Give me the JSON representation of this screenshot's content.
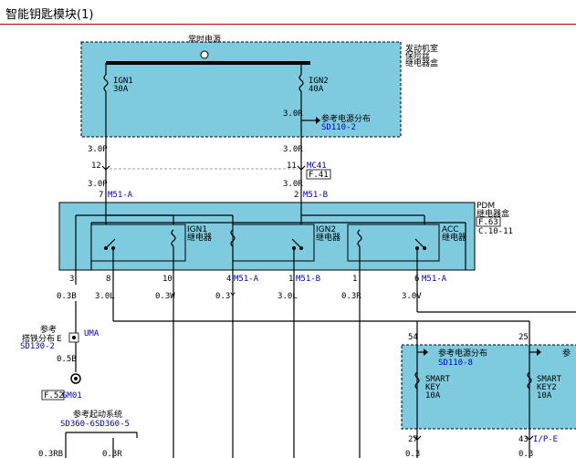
{
  "title": "智能钥匙模块(1)",
  "constant_power": "常时电源",
  "engine_room": {
    "line1": "发动机室",
    "line2": "继电器盒",
    "overlap": "保险丝"
  },
  "fuses": [
    {
      "name": "IGN1",
      "rating": "30A"
    },
    {
      "name": "IGN2",
      "rating": "40A"
    }
  ],
  "ref_power_top": {
    "label": "参考电源分布",
    "code": "SD110-2"
  },
  "wires_top": {
    "w1": "3.0P",
    "w2": "3.0R",
    "w3": "3.0R",
    "w4": "3.0P",
    "w5": "3.0R"
  },
  "connector_mc41": {
    "pin12": "12",
    "pin11": "11",
    "name": "MC41",
    "page": "F.41"
  },
  "pdm": {
    "line1": "PDM",
    "line2": "继电器盒",
    "page": "F.63",
    "ref": "C.10-11",
    "pin7": "7",
    "conn_a": "M51-A",
    "pin2": "2",
    "conn_b": "M51-B"
  },
  "relays": [
    {
      "name": "IGN1",
      "label": "继电器"
    },
    {
      "name": "IGN2",
      "label": "继电器"
    },
    {
      "name": "ACC",
      "label": "继电器"
    }
  ],
  "bottom_pins": [
    {
      "pin": "3",
      "conn": "",
      "wire": "0.3B"
    },
    {
      "pin": "8",
      "conn": "",
      "wire": "3.0L"
    },
    {
      "pin": "10",
      "conn": "",
      "wire": "0.3W"
    },
    {
      "pin": "4",
      "conn": "M51-A",
      "wire": "0.3Y"
    },
    {
      "pin": "1",
      "conn": "M51-B",
      "wire": "3.0L"
    },
    {
      "pin": "1",
      "conn": "",
      "wire": "0.3R"
    },
    {
      "pin": "6",
      "conn": "M51-A",
      "wire": "3.0V"
    }
  ],
  "ground": {
    "ref": "参考",
    "label": "搭铁分布",
    "code": "SD130-2",
    "overlap": "E",
    "uma": "UMA",
    "wire": "0.5B",
    "page": "F.52",
    "gm01": "GM01"
  },
  "start_system": {
    "label": "参考起动系统",
    "code1": "SD360-6",
    "code2": "SD360-5",
    "wire1": "0.3RB",
    "wire2": "0.3R"
  },
  "right_box": {
    "pin54": "54",
    "pin25": "25",
    "ref_label": "参考电源分布",
    "ref_code": "SD110-8",
    "partial": "参",
    "fuse1": {
      "name": "SMART",
      "name2": "KEY",
      "rating": "10A"
    },
    "fuse2": {
      "name": "SMART",
      "name2": "KEY2",
      "rating": "10A"
    },
    "pin27": "27",
    "pin43": "43",
    "conn": "I/P-E",
    "wire1": "0.3",
    "wire2": "0.3"
  }
}
